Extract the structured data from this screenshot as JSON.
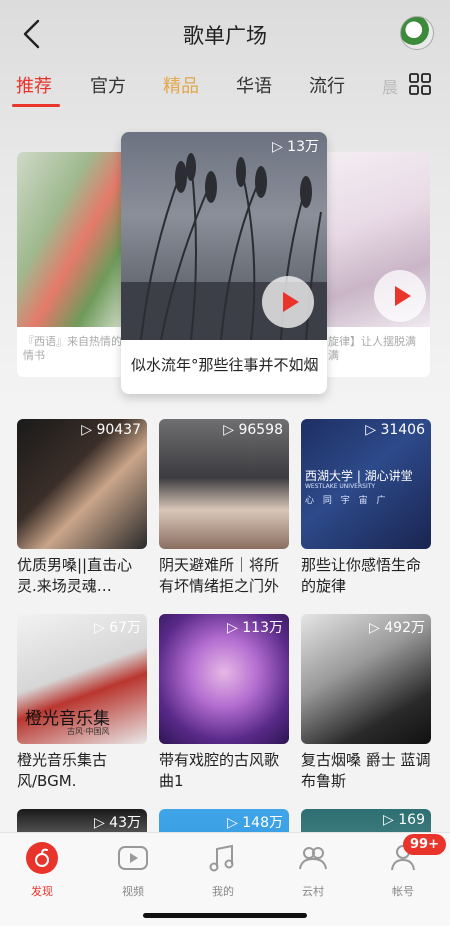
{
  "header": {
    "title": "歌单广场"
  },
  "tabs": [
    {
      "label": "推荐",
      "state": "active"
    },
    {
      "label": "官方",
      "state": "normal"
    },
    {
      "label": "精品",
      "state": "highlight"
    },
    {
      "label": "华语",
      "state": "normal"
    },
    {
      "label": "流行",
      "state": "normal"
    }
  ],
  "tabs_more": "晨",
  "carousel": {
    "left": {
      "caption": "『西语』来自热情的情书"
    },
    "center": {
      "caption": "似水流年°那些往事并不如烟",
      "count": "13万"
    },
    "right": {
      "caption": "旋律】让人摆脱满满"
    }
  },
  "playlists": [
    {
      "name": "优质男嗓||直击心灵.来场灵魂…",
      "count": "90437"
    },
    {
      "name": "阴天避难所｜将所有坏情绪拒之门外",
      "count": "96598"
    },
    {
      "name": "那些让你感悟生命的旋律",
      "count": "31406"
    },
    {
      "name": "橙光音乐集古风/BGM.",
      "count": "67万"
    },
    {
      "name": "带有戏腔的古风歌曲1",
      "count": "113万"
    },
    {
      "name": "复古烟嗓 爵士 蓝调布鲁斯",
      "count": "492万"
    },
    {
      "name": "",
      "count": "43万"
    },
    {
      "name": "",
      "count": "148万"
    },
    {
      "name": "",
      "count": "169"
    }
  ],
  "thumb_text": {
    "westlake": "西湖大学 | 湖心讲堂",
    "westlake_en": "WESTLAKE UNIVERSITY",
    "westlake_sub": "心 同 宇 宙 广",
    "orange": "橙光音乐集",
    "orange_sub": "古风·中国风"
  },
  "tabbar": [
    {
      "label": "发现",
      "icon": "discover-icon"
    },
    {
      "label": "视频",
      "icon": "video-icon"
    },
    {
      "label": "我的",
      "icon": "music-note-icon"
    },
    {
      "label": "云村",
      "icon": "community-icon"
    },
    {
      "label": "帐号",
      "icon": "account-icon"
    }
  ],
  "badge": "99+",
  "colors": {
    "accent": "#e8342b",
    "highlight_tab": "#e2a84b"
  }
}
